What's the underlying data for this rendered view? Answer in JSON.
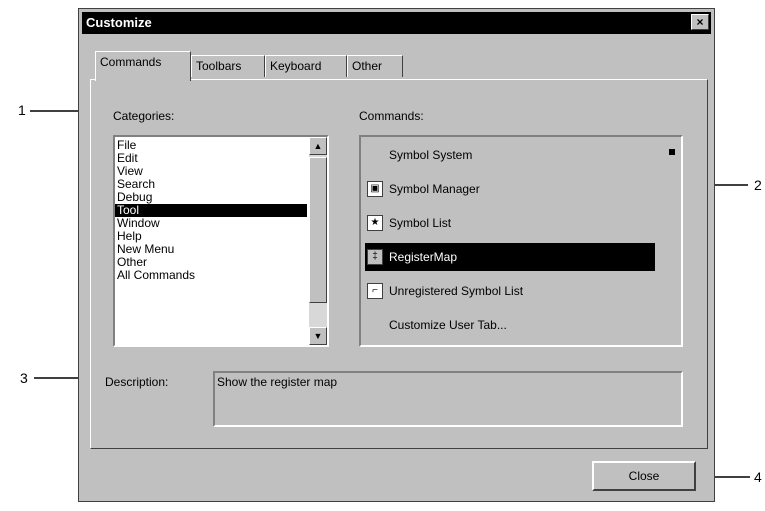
{
  "window": {
    "title": "Customize",
    "close_glyph": "×"
  },
  "tabs": [
    {
      "label": "Commands"
    },
    {
      "label": "Toolbars"
    },
    {
      "label": "Keyboard"
    },
    {
      "label": "Other"
    }
  ],
  "categories": {
    "label": "Categories:",
    "items": [
      "File",
      "Edit",
      "View",
      "Search",
      "Debug",
      "Tool",
      "Window",
      "Help",
      "New Menu",
      "Other",
      "All Commands"
    ],
    "selected": "Tool"
  },
  "commands": {
    "label": "Commands:",
    "items": [
      {
        "label": "Symbol System",
        "icon": "none"
      },
      {
        "label": "Symbol Manager",
        "icon": "symbol-manager-icon"
      },
      {
        "label": "Symbol List",
        "icon": "star-icon"
      },
      {
        "label": "RegisterMap",
        "icon": "register-map-icon"
      },
      {
        "label": "Unregistered Symbol List",
        "icon": "unregistered-symbol-icon"
      },
      {
        "label": "Customize User Tab...",
        "icon": "none"
      }
    ],
    "selected": "RegisterMap"
  },
  "description": {
    "label": "Description:",
    "text": "Show the register map"
  },
  "buttons": {
    "close": "Close"
  },
  "callouts": [
    "1",
    "2",
    "3",
    "4"
  ]
}
